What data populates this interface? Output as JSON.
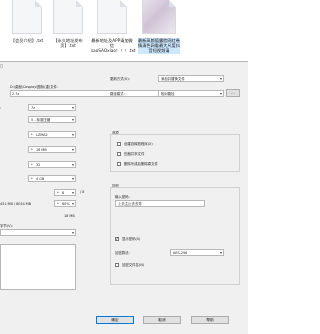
{
  "desktop": {
    "files": [
      {
        "name": "【会员介绍】.txt"
      },
      {
        "name": "【永久地址发布页】.txt"
      },
      {
        "name": "最新地址及APP请加微信saoSAOxiao！！！.txt"
      },
      {
        "name": "最新高颜值露脸网红卷情清色网看最大尺度抖音短视频请"
      }
    ]
  },
  "dialog": {
    "archive_label": "D:\\桌面\\Cosplay\\图标(重)文件:",
    "archive_path": "2.7z",
    "browse_label": "...",
    "format_value": "7z",
    "compression_value": "5 - 标准压缩",
    "method_value": "LZMA2",
    "dict_value": "16 MB",
    "word_value": "32",
    "block_value": "4 GB",
    "threads_value": "8",
    "threads_total": "/ 8",
    "memory_text": "431 MB / 8034 MB",
    "memory_percent": "80%",
    "decompress_mem": "18 MB",
    "split_label": "字节(V):",
    "update_label": "更新方式(U):",
    "update_value": "添加并替换文件",
    "path_label": "路径模式:",
    "path_value": "相对路径",
    "options_label": "选项",
    "opt_sfx": "创建自释放程序(X)",
    "opt_shared": "压缩共享文件",
    "opt_delete": "删除写成后删除原文件",
    "encrypt_label": "加密",
    "password_label": "输入密码:",
    "password_value": "上去主止去去芳",
    "show_password": "显示密码(S)",
    "encmethod_label": "加密算法:",
    "encmethod_value": "AES-256",
    "encrypt_names": "加密文件名(N)",
    "ok_label": "确定",
    "cancel_label": "取消",
    "help_label": "帮助"
  }
}
